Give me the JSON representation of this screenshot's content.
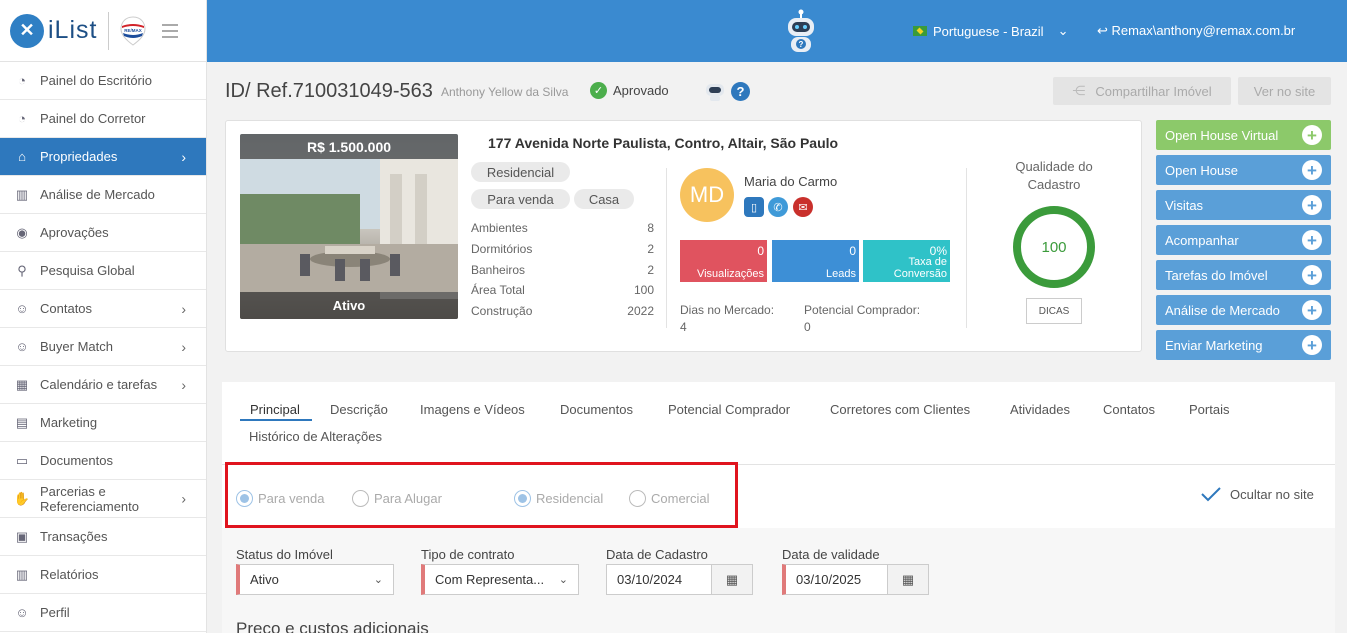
{
  "brand": {
    "logo_text": "iList"
  },
  "sidebar": {
    "items": [
      {
        "label": "Painel do Escritório"
      },
      {
        "label": "Painel do Corretor"
      },
      {
        "label": "Propriedades"
      },
      {
        "label": "Análise de Mercado"
      },
      {
        "label": "Aprovações"
      },
      {
        "label": "Pesquisa Global"
      },
      {
        "label": "Contatos"
      },
      {
        "label": "Buyer Match"
      },
      {
        "label": "Calendário e tarefas"
      },
      {
        "label": "Marketing"
      },
      {
        "label": "Documentos"
      },
      {
        "label": "Parcerias e Referenciamento"
      },
      {
        "label": "Transações"
      },
      {
        "label": "Relatórios"
      },
      {
        "label": "Perfil"
      }
    ]
  },
  "topbar": {
    "language": "Portuguese - Brazil",
    "user": "Remax\\anthony@remax.com.br"
  },
  "header": {
    "ref": "ID/ Ref.710031049-563",
    "owner": "Anthony Yellow da Silva",
    "status": "Aprovado",
    "share_label": "Compartilhar Imóvel",
    "view_site_label": "Ver no site"
  },
  "property": {
    "price": "R$ 1.500.000",
    "photo_status": "Ativo",
    "address": "177 Avenida Norte Paulista, Contro, Altair, São Paulo",
    "tags": [
      "Residencial",
      "Para venda",
      "Casa"
    ],
    "specs": [
      {
        "label": "Ambientes",
        "value": "8"
      },
      {
        "label": "Dormitórios",
        "value": "2"
      },
      {
        "label": "Banheiros",
        "value": "2"
      },
      {
        "label": "Área Total",
        "value": "100"
      },
      {
        "label": "Construção",
        "value": "2022"
      }
    ]
  },
  "agent": {
    "initials": "MD",
    "name": "Maria do Carmo",
    "stats": [
      {
        "value": "0",
        "label": "Visualizações",
        "color": "#e0535f"
      },
      {
        "value": "0",
        "label": "Leads",
        "color": "#3d8fd6"
      },
      {
        "value": "0%",
        "label": "Taxa de Conversão",
        "color": "#2fc2c8"
      }
    ],
    "days_label": "Dias no Mercado:",
    "days_value": "4",
    "buyers_label": "Potencial Comprador:",
    "buyers_value": "0"
  },
  "quality": {
    "title": "Qualidade do Cadastro",
    "score": "100",
    "tips_label": "DICAS"
  },
  "actions": [
    {
      "label": "Open House Virtual",
      "color": "#8cc96a"
    },
    {
      "label": "Open House",
      "color": "#5a9fd8"
    },
    {
      "label": "Visitas",
      "color": "#5a9fd8"
    },
    {
      "label": "Acompanhar",
      "color": "#5a9fd8"
    },
    {
      "label": "Tarefas do Imóvel",
      "color": "#5a9fd8"
    },
    {
      "label": "Análise de Mercado",
      "color": "#5a9fd8"
    },
    {
      "label": "Enviar Marketing",
      "color": "#5a9fd8"
    }
  ],
  "tabs": [
    "Principal",
    "Descrição",
    "Imagens e Vídeos",
    "Documentos",
    "Potencial Comprador",
    "Corretores com Clientes",
    "Atividades",
    "Contatos",
    "Portais",
    "Histórico de Alterações"
  ],
  "options": {
    "radios": [
      {
        "label": "Para venda",
        "checked": true
      },
      {
        "label": "Para Alugar",
        "checked": false
      },
      {
        "label": "Residencial",
        "checked": true
      },
      {
        "label": "Comercial",
        "checked": false
      }
    ],
    "hide_site": "Ocultar no site"
  },
  "form": {
    "status_label": "Status do Imóvel",
    "status_value": "Ativo",
    "contract_label": "Tipo de contrato",
    "contract_value": "Com Representa...",
    "reg_date_label": "Data de Cadastro",
    "reg_date_value": "03/10/2024",
    "valid_date_label": "Data de validade",
    "valid_date_value": "03/10/2025",
    "section_title": "Preço e custos adicionais"
  }
}
